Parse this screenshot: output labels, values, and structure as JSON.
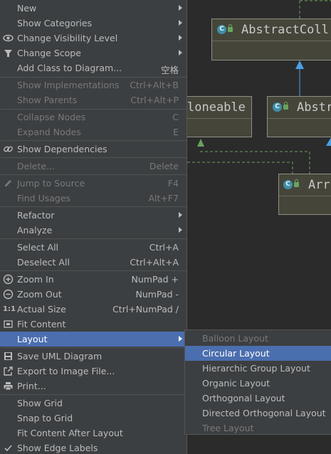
{
  "diagram": {
    "nodes": [
      {
        "id": "abstract-collection",
        "title": "AbstractColl"
      },
      {
        "id": "cloneable",
        "title": "loneable"
      },
      {
        "id": "abstract-list",
        "title": "Abstr"
      },
      {
        "id": "array-list",
        "title": "Arr"
      }
    ],
    "class_icon_letter": "C",
    "colors": {
      "canvas": "#2b2b2b",
      "node_fill": "#45453a",
      "implements": "#69a35c",
      "extends": "#4a9fe6"
    }
  },
  "menu": {
    "items": [
      {
        "label": "New",
        "shortcut": "",
        "submenu": true,
        "enabled": true,
        "icon": ""
      },
      {
        "label": "Show Categories",
        "shortcut": "",
        "submenu": true,
        "enabled": true,
        "icon": ""
      },
      {
        "label": "Change Visibility Level",
        "shortcut": "",
        "submenu": true,
        "enabled": true,
        "icon": "eye-icon"
      },
      {
        "label": "Change Scope",
        "shortcut": "",
        "submenu": true,
        "enabled": true,
        "icon": "filter-icon"
      },
      {
        "label": "Add Class to Diagram...",
        "shortcut": "空格",
        "submenu": false,
        "enabled": true,
        "icon": ""
      },
      {
        "label": "Show Implementations",
        "shortcut": "Ctrl+Alt+B",
        "submenu": false,
        "enabled": false,
        "icon": ""
      },
      {
        "label": "Show Parents",
        "shortcut": "Ctrl+Alt+P",
        "submenu": false,
        "enabled": false,
        "icon": ""
      },
      {
        "label": "Collapse Nodes",
        "shortcut": "C",
        "submenu": false,
        "enabled": false,
        "icon": ""
      },
      {
        "label": "Expand Nodes",
        "shortcut": "E",
        "submenu": false,
        "enabled": false,
        "icon": ""
      },
      {
        "label": "Show Dependencies",
        "shortcut": "",
        "submenu": false,
        "enabled": true,
        "icon": "link-icon"
      },
      {
        "label": "Delete...",
        "shortcut": "Delete",
        "submenu": false,
        "enabled": false,
        "icon": ""
      },
      {
        "label": "Jump to Source",
        "shortcut": "F4",
        "submenu": false,
        "enabled": false,
        "icon": "edit-icon"
      },
      {
        "label": "Find Usages",
        "shortcut": "Alt+F7",
        "submenu": false,
        "enabled": false,
        "icon": ""
      },
      {
        "label": "Refactor",
        "shortcut": "",
        "submenu": true,
        "enabled": true,
        "icon": ""
      },
      {
        "label": "Analyze",
        "shortcut": "",
        "submenu": true,
        "enabled": true,
        "icon": ""
      },
      {
        "label": "Select All",
        "shortcut": "Ctrl+A",
        "submenu": false,
        "enabled": true,
        "icon": ""
      },
      {
        "label": "Deselect All",
        "shortcut": "Ctrl+Alt+A",
        "submenu": false,
        "enabled": true,
        "icon": ""
      },
      {
        "label": "Zoom In",
        "shortcut": "NumPad +",
        "submenu": false,
        "enabled": true,
        "icon": "zoom-in-icon"
      },
      {
        "label": "Zoom Out",
        "shortcut": "NumPad -",
        "submenu": false,
        "enabled": true,
        "icon": "zoom-out-icon"
      },
      {
        "label": "Actual Size",
        "shortcut": "Ctrl+NumPad /",
        "submenu": false,
        "enabled": true,
        "icon": "actual-size-icon"
      },
      {
        "label": "Fit Content",
        "shortcut": "",
        "submenu": false,
        "enabled": true,
        "icon": "fit-content-icon"
      },
      {
        "label": "Layout",
        "shortcut": "",
        "submenu": true,
        "enabled": true,
        "icon": "",
        "selected": true
      },
      {
        "label": "Save UML Diagram",
        "shortcut": "",
        "submenu": false,
        "enabled": true,
        "icon": "save-icon"
      },
      {
        "label": "Export to Image File...",
        "shortcut": "",
        "submenu": false,
        "enabled": true,
        "icon": "export-icon"
      },
      {
        "label": "Print...",
        "shortcut": "",
        "submenu": false,
        "enabled": true,
        "icon": "print-icon"
      },
      {
        "label": "Show Grid",
        "shortcut": "",
        "submenu": false,
        "enabled": true,
        "icon": ""
      },
      {
        "label": "Snap to Grid",
        "shortcut": "",
        "submenu": false,
        "enabled": true,
        "icon": ""
      },
      {
        "label": "Fit Content After Layout",
        "shortcut": "",
        "submenu": false,
        "enabled": true,
        "icon": ""
      },
      {
        "label": "Show Edge Labels",
        "shortcut": "",
        "submenu": false,
        "enabled": true,
        "icon": "check-icon",
        "checked": true
      }
    ],
    "actual_size_glyph": "1:1"
  },
  "layout_submenu": {
    "items": [
      {
        "label": "Balloon Layout",
        "enabled": false
      },
      {
        "label": "Circular Layout",
        "enabled": true,
        "selected": true
      },
      {
        "label": "Hierarchic Group Layout",
        "enabled": true
      },
      {
        "label": "Organic Layout",
        "enabled": true
      },
      {
        "label": "Orthogonal Layout",
        "enabled": true
      },
      {
        "label": "Directed Orthogonal Layout",
        "enabled": true
      },
      {
        "label": "Tree Layout",
        "enabled": false
      }
    ]
  }
}
